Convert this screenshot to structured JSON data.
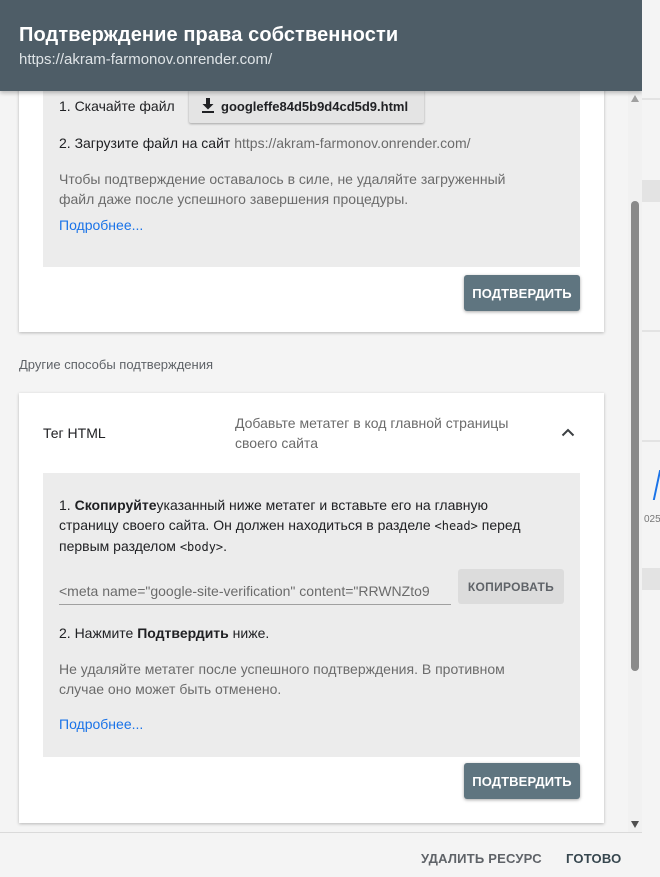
{
  "dialog": {
    "title": "Подтверждение права собственности",
    "subtitle": "https://akram-farmonov.onrender.com/"
  },
  "file_method": {
    "step1_label": "1. Скачайте файл",
    "download_file": "googleffe84d5b9d4cd5d9.html",
    "step2_prefix": "2. Загрузите файл на сайт",
    "step2_url": "https://akram-farmonov.onrender.com/",
    "note_line1": "Чтобы подтверждение оставалось в силе, не удаляйте загруженный",
    "note_line2": "файл даже после успешного завершения процедуры.",
    "more_link": "Подробнее...",
    "confirm_label": "ПОДТВЕРДИТЬ"
  },
  "other_methods": {
    "heading": "Другие способы подтверждения",
    "html_tag": {
      "name": "Тег HTML",
      "description_line1": "Добавьте метатег в код главной страницы",
      "description_line2": "своего сайта",
      "step1_num": "1.",
      "step1_bold": "Скопируйте",
      "step1_line1_rest": "указанный ниже метатег и вставьте его на главную",
      "step1_line2_prefix": "страницу своего сайта. Он должен находиться в разделе",
      "head_tag": "<head>",
      "step1_line2_suffix": "перед",
      "step1_line3_prefix": "первым разделом",
      "body_tag": "<body>",
      "step1_line3_suffix": ".",
      "meta_value": "<meta name=\"google-site-verification\" content=\"RRWNZto9",
      "copy_label": "КОПИРОВАТЬ",
      "step2_prefix": "2. Нажмите",
      "step2_bold": "Подтвердить",
      "step2_suffix": "ниже.",
      "note_line1": "Не удаляйте метатег после успешного подтверждения. В противном",
      "note_line2": "случае оно может быть отменено.",
      "more_link": "Подробнее...",
      "confirm_label": "ПОДТВЕРДИТЬ"
    }
  },
  "footer": {
    "delete_label": "УДАЛИТЬ РЕСУРС",
    "done_label": "ГОТОВО"
  },
  "background": {
    "tick_label": "025"
  },
  "colors": {
    "header": "#4e5d67",
    "confirm_button": "#5f7580",
    "link": "#1a73e8"
  }
}
